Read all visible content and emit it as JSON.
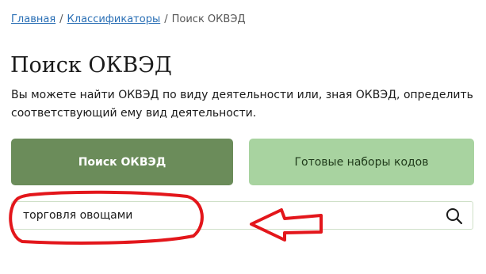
{
  "breadcrumb": {
    "items": [
      {
        "label": "Главная"
      },
      {
        "label": "Классификаторы"
      }
    ],
    "separator": "/",
    "current": "Поиск ОКВЭД"
  },
  "page": {
    "title": "Поиск ОКВЭД",
    "description": "Вы можете найти ОКВЭД по виду деятельности или, зная ОКВЭД, определить соответствующий ему вид деятельности."
  },
  "tabs": [
    {
      "label": "Поиск ОКВЭД",
      "active": true
    },
    {
      "label": "Готовые наборы кодов",
      "active": false
    }
  ],
  "search": {
    "value": "торговля овощами",
    "icon": "search-icon"
  },
  "annotation": {
    "color": "#e3161b",
    "shapes": [
      "ellipse-highlight",
      "arrow-left"
    ]
  },
  "colors": {
    "link": "#2a6fb5",
    "tab_active": "#6b8c5a",
    "tab_inactive": "#a8d3a0",
    "annotation": "#e3161b"
  }
}
